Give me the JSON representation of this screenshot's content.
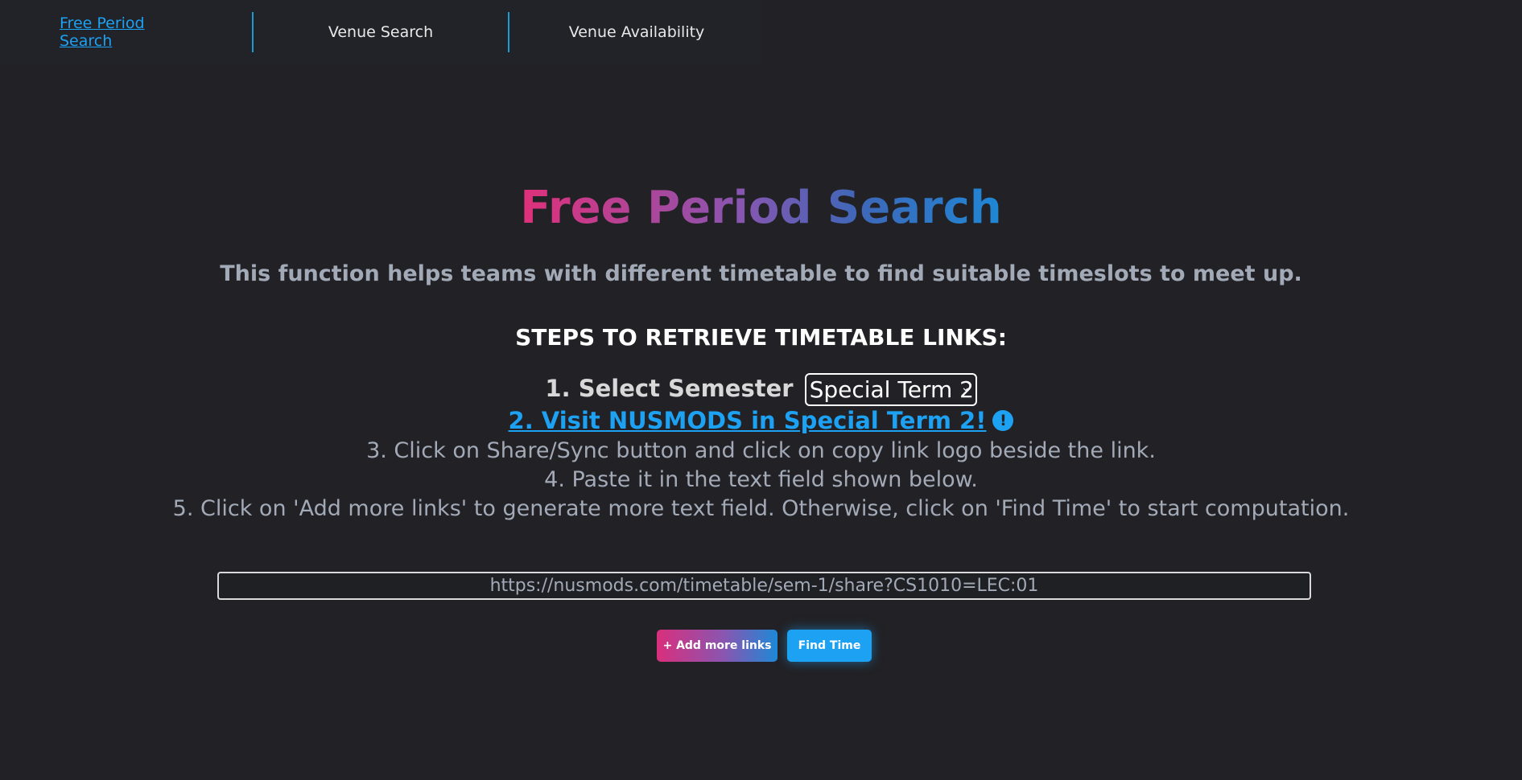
{
  "nav": {
    "items": [
      {
        "label": "Free Period Search",
        "active": true
      },
      {
        "label": "Venue Search",
        "active": false
      },
      {
        "label": "Venue Availability",
        "active": false
      }
    ],
    "accent_color": "#1da1f2"
  },
  "main": {
    "title": "Free Period Search",
    "subtitle": "This function helps teams with different timetable to find suitable timeslots to meet up.",
    "steps_heading": "STEPS TO RETRIEVE TIMETABLE LINKS:",
    "step1_label": "1. Select Semester",
    "semester_selected": "Special Term 2",
    "step2_link": "2. Visit NUSMODS in Special Term 2!",
    "step2_icon": "exclamation-circle-icon",
    "step3": "3. Click on Share/Sync button and click on copy link logo beside the link.",
    "step4": "4. Paste it in the text field shown below.",
    "step5": "5. Click on 'Add more links' to generate more text field. Otherwise, click on 'Find Time' to start computation.",
    "link_input_placeholder": "https://nusmods.com/timetable/sem-1/share?CS1010=LEC:01",
    "add_more_label": "+ Add more links",
    "find_time_label": "Find Time"
  }
}
